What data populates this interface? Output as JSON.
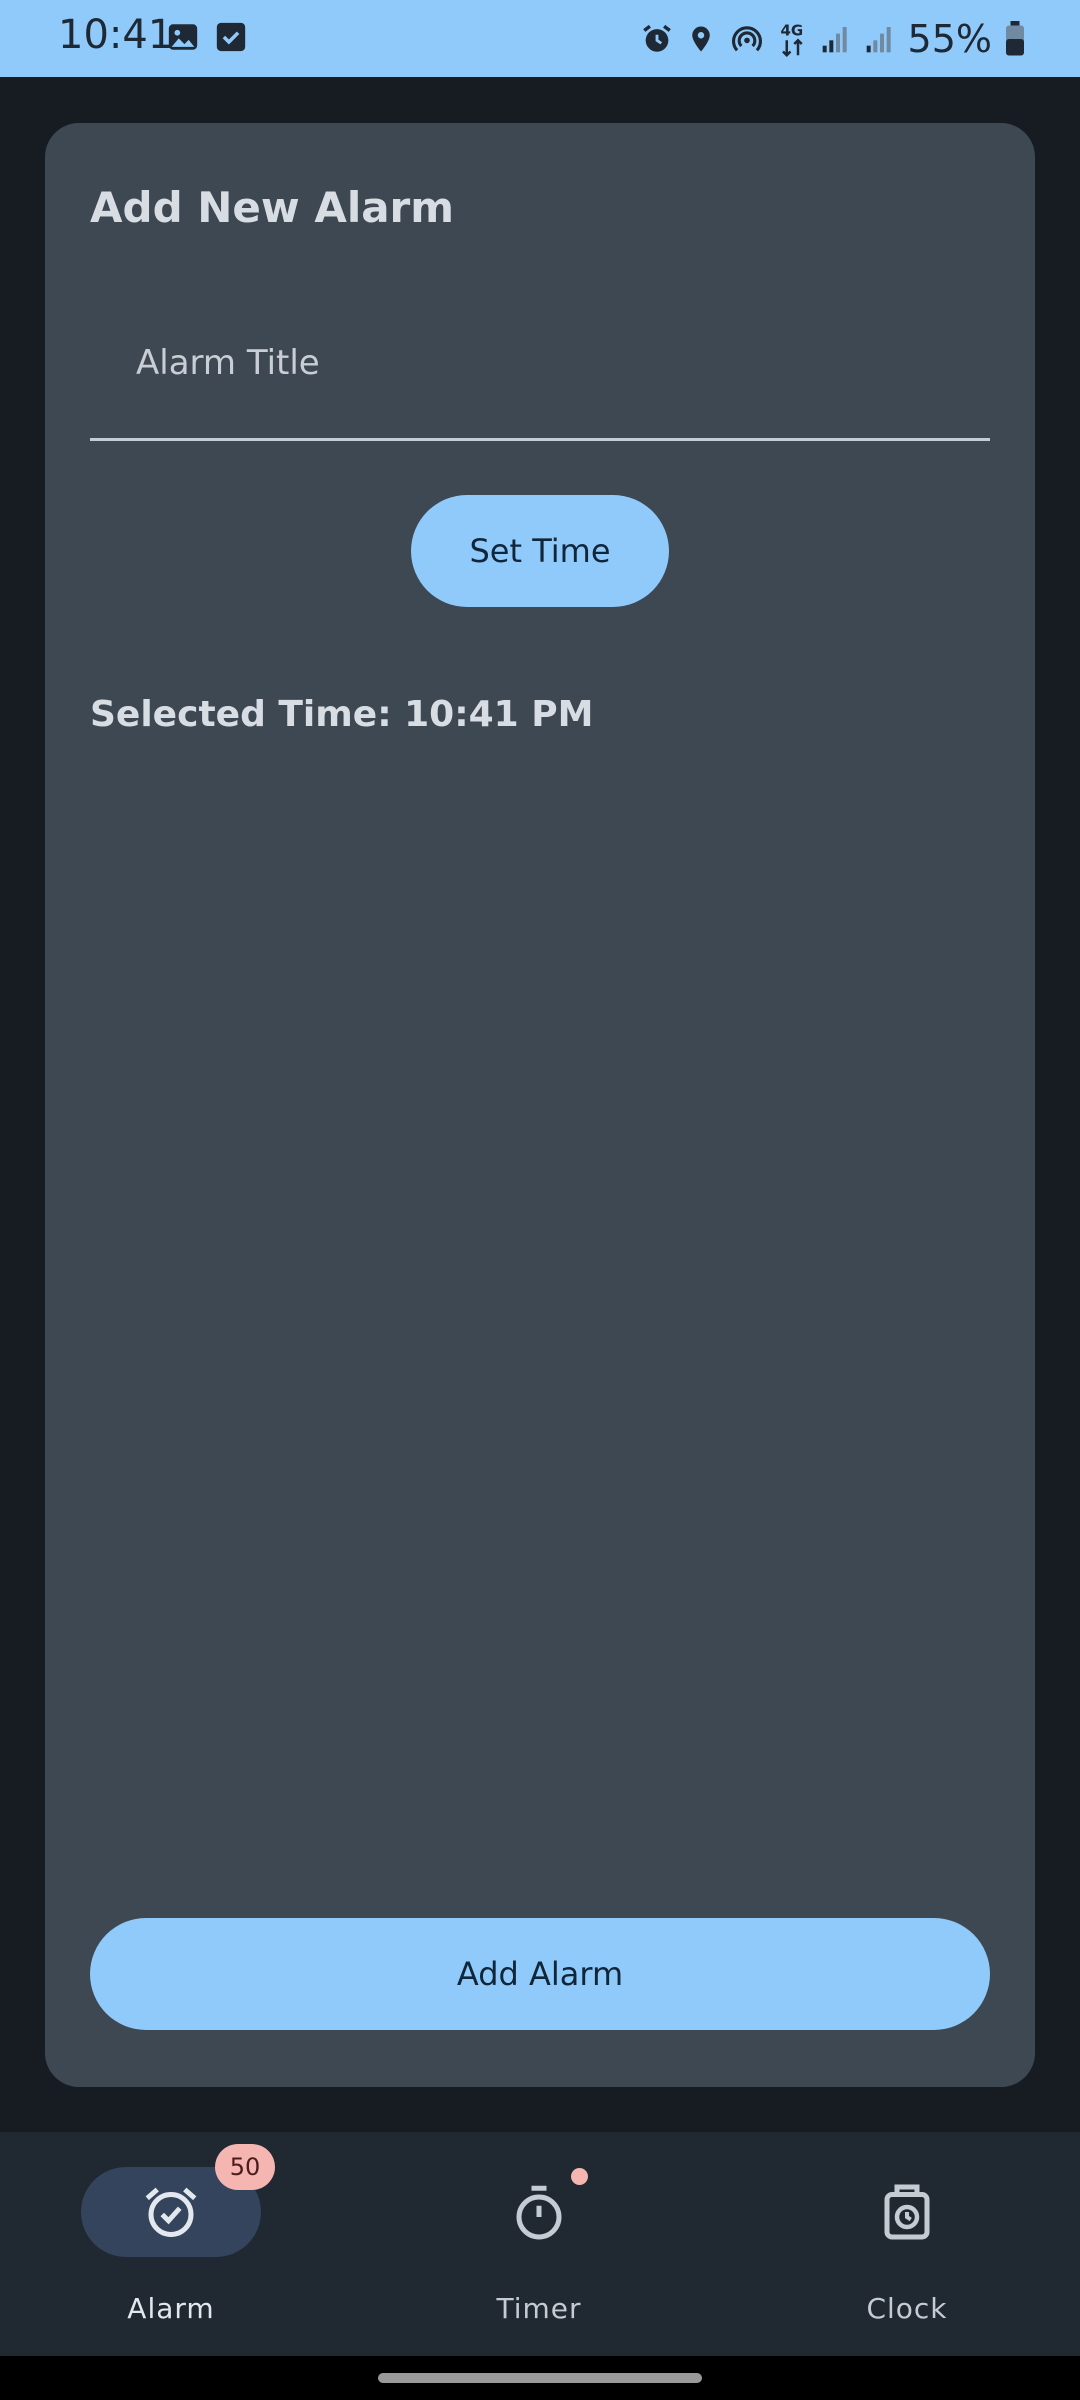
{
  "status_bar": {
    "time": "10:41",
    "network": "4G",
    "battery": "55%",
    "left_icons": [
      "image-icon",
      "checkbox-icon"
    ],
    "right_icons": [
      "alarm-icon",
      "location-icon",
      "hotspot-icon",
      "network-4g-icon",
      "signal-icon",
      "signal-icon",
      "battery-icon"
    ]
  },
  "form": {
    "title": "Add New Alarm",
    "title_input": {
      "placeholder": "Alarm Title",
      "value": ""
    },
    "set_time_label": "Set Time",
    "selected_time": "Selected Time: 10:41 PM",
    "add_alarm_label": "Add Alarm"
  },
  "bottom_nav": {
    "items": [
      {
        "label": "Alarm",
        "icon": "alarm-check-icon",
        "badge": "50",
        "selected": true
      },
      {
        "label": "Timer",
        "icon": "stopwatch-icon",
        "dot": true,
        "selected": false
      },
      {
        "label": "Clock",
        "icon": "clock-icon",
        "selected": false
      }
    ]
  },
  "colors": {
    "accent": "#90cafa",
    "background": "#171c22",
    "card": "#3e4852",
    "nav_background": "#202831",
    "badge": "#f5b6b2"
  }
}
